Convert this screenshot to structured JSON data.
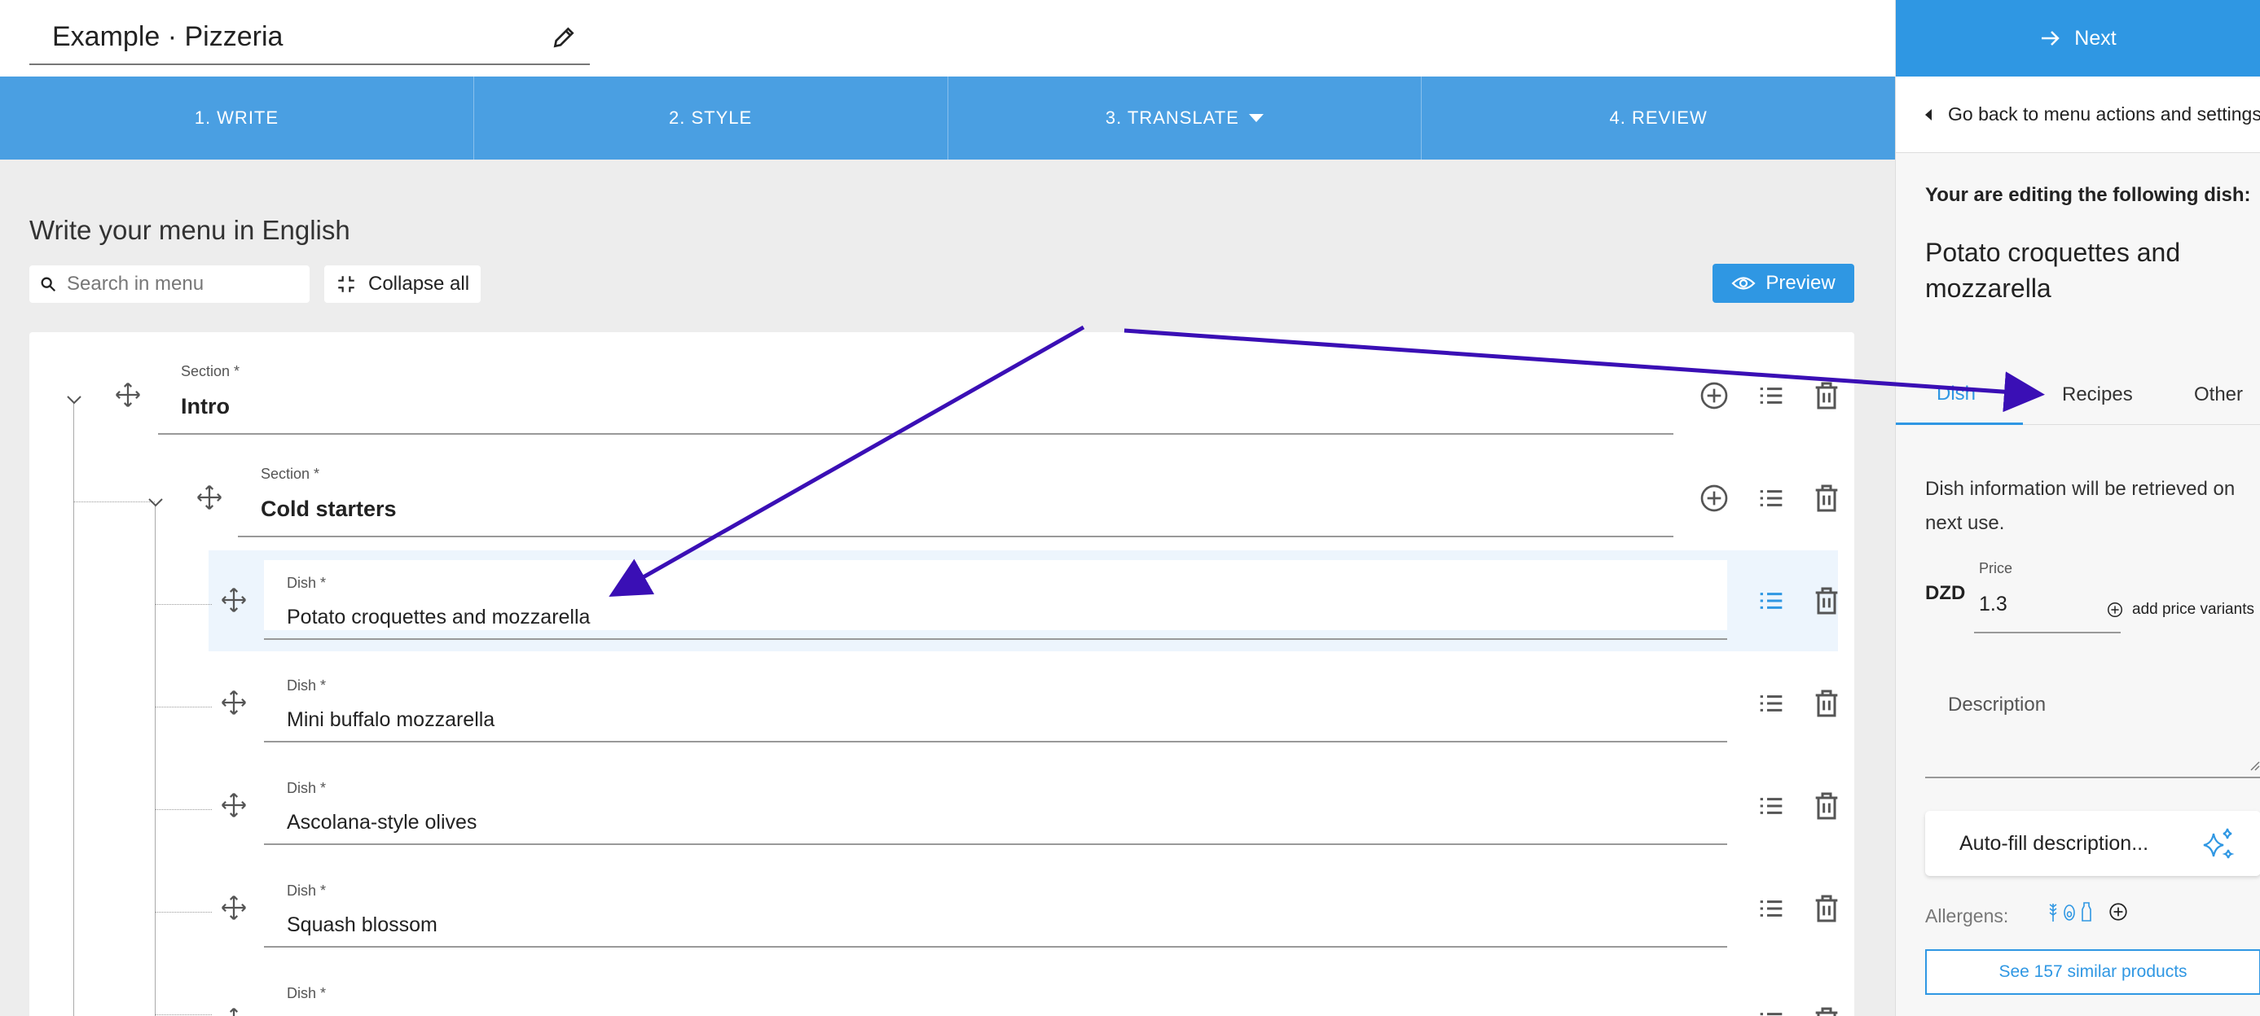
{
  "header": {
    "menu_title": "Example · Pizzeria",
    "edit_icon": "pencil-icon"
  },
  "steps": [
    {
      "label": "1. WRITE",
      "active": true
    },
    {
      "label": "2. STYLE"
    },
    {
      "label": "3. TRANSLATE",
      "has_dropdown": true
    },
    {
      "label": "4. REVIEW"
    }
  ],
  "main": {
    "heading": "Write your menu in English",
    "search_placeholder": "Search in menu",
    "collapse_label": "Collapse all",
    "preview_label": "Preview"
  },
  "menu": {
    "section_label": "Section *",
    "dish_label": "Dish *",
    "sections": [
      {
        "name": "Intro"
      },
      {
        "name": "Cold starters"
      }
    ],
    "dishes": [
      {
        "name": "Potato croquettes and mozzarella",
        "selected": true
      },
      {
        "name": "Mini buffalo mozzarella"
      },
      {
        "name": "Ascolana-style olives"
      },
      {
        "name": "Squash blossom"
      },
      {
        "name": ""
      }
    ]
  },
  "panel": {
    "next_label": "Next",
    "back_label": "Go back to menu actions and settings",
    "editing_label": "Your are editing the following dish:",
    "dish_name": "Potato croquettes and mozzarella",
    "tabs": [
      "Dish",
      "Recipes",
      "Other"
    ],
    "active_tab": "Dish",
    "info_text": "Dish information will be retrieved on next use.",
    "currency": "DZD",
    "price_label": "Price",
    "price_value": "1.3",
    "add_variants_label": "add price variants",
    "description_label": "Description",
    "autofill_label": "Auto-fill description...",
    "allergens_label": "Allergens:",
    "similar_label": "See 157 similar products"
  },
  "colors": {
    "steps_bar": "#4a9fe2",
    "primary": "#2f97e3",
    "arrow": "#3a0fb5",
    "main_bg": "#ededed"
  }
}
